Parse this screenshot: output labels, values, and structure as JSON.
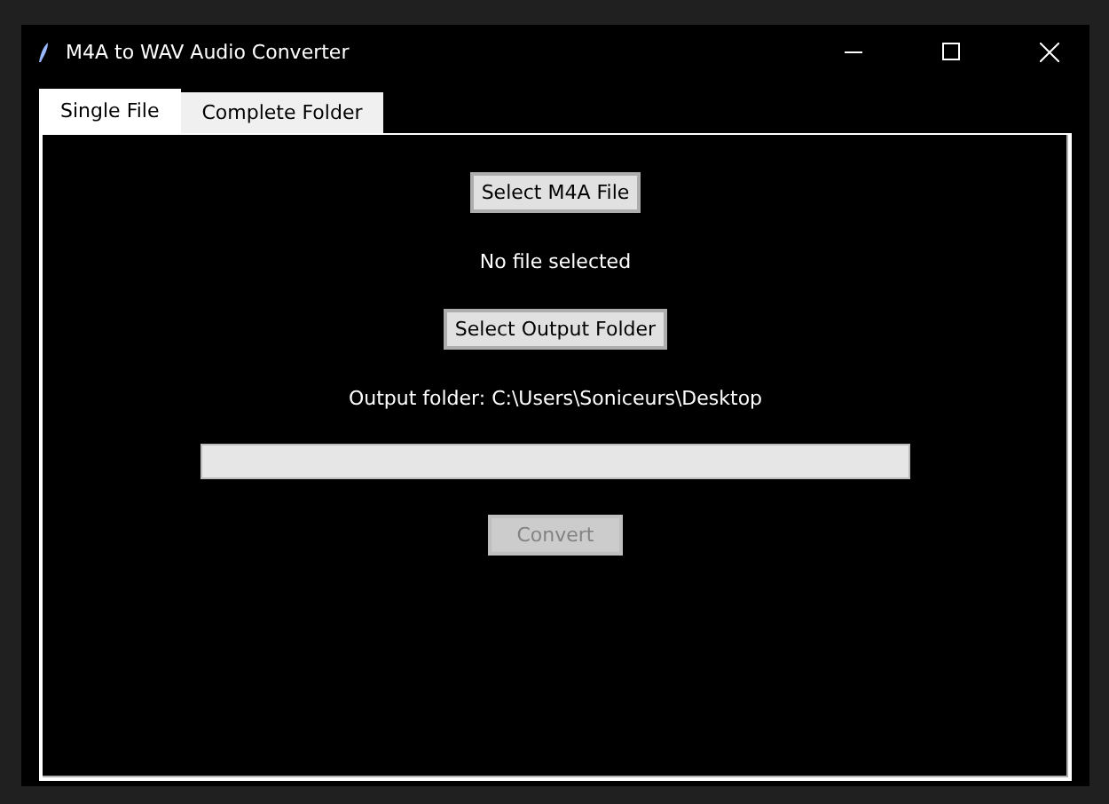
{
  "window": {
    "title": "M4A to WAV Audio Converter"
  },
  "tabs": [
    {
      "label": "Single File",
      "selected": true
    },
    {
      "label": "Complete Folder",
      "selected": false
    }
  ],
  "select_file_button": {
    "label": "Select M4A File",
    "disabled": false
  },
  "file_status": "No file selected",
  "select_output_button": {
    "label": "Select Output Folder",
    "disabled": false
  },
  "output_folder": "Output folder: C:\\Users\\Soniceurs\\Desktop",
  "progress": {
    "level": 0
  },
  "convert_button": {
    "label": "Convert",
    "disabled": true
  }
}
